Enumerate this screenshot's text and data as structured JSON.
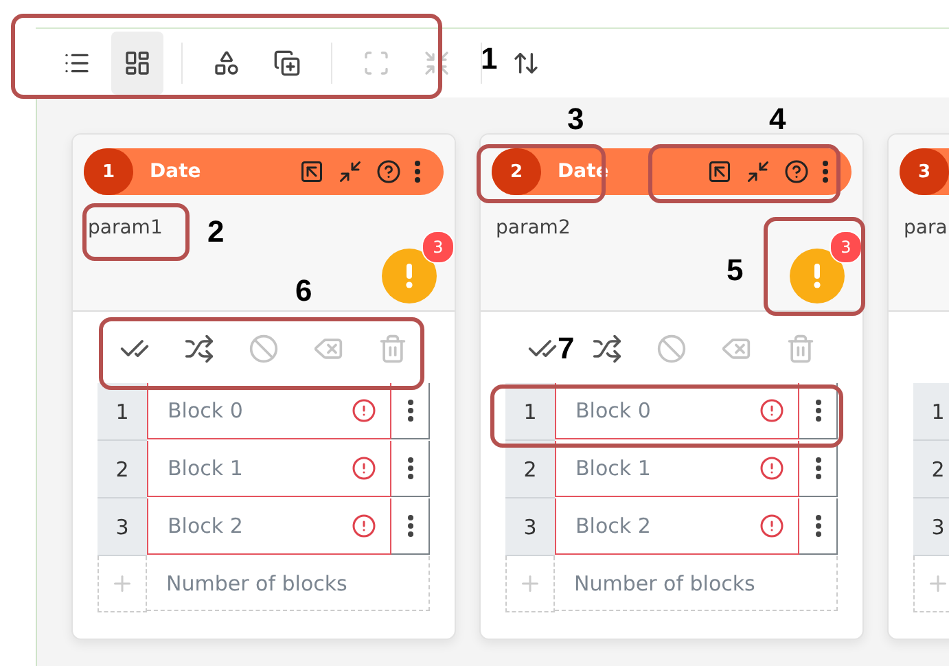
{
  "toolbar": {
    "buttons": [
      {
        "kind": "list",
        "selected": false,
        "disabled": false
      },
      {
        "kind": "dashboard",
        "selected": true,
        "disabled": false
      },
      {
        "kind": "add-shapes",
        "selected": false,
        "disabled": false
      },
      {
        "kind": "copy-plus",
        "selected": false,
        "disabled": false
      },
      {
        "kind": "expand",
        "selected": false,
        "disabled": true
      },
      {
        "kind": "shrink",
        "selected": false,
        "disabled": true
      },
      {
        "kind": "sort",
        "selected": false,
        "disabled": false
      }
    ]
  },
  "cards": [
    {
      "number": "1",
      "label": "Date",
      "title": "param1",
      "alert_count": "3",
      "actions": [
        {
          "kind": "check-all",
          "disabled": false
        },
        {
          "kind": "shuffle",
          "disabled": false
        },
        {
          "kind": "ban",
          "disabled": true
        },
        {
          "kind": "backspace",
          "disabled": true
        },
        {
          "kind": "trash",
          "disabled": true
        }
      ],
      "rows": [
        {
          "index": "1",
          "name": "Block 0",
          "error": true
        },
        {
          "index": "2",
          "name": "Block 1",
          "error": true
        },
        {
          "index": "3",
          "name": "Block 2",
          "error": true
        }
      ],
      "add_placeholder": "Number of blocks"
    },
    {
      "number": "2",
      "label": "Date",
      "title": "param2",
      "alert_count": "3",
      "actions": [
        {
          "kind": "check-all",
          "disabled": false
        },
        {
          "kind": "shuffle",
          "disabled": false
        },
        {
          "kind": "ban",
          "disabled": true
        },
        {
          "kind": "backspace",
          "disabled": true
        },
        {
          "kind": "trash",
          "disabled": true
        }
      ],
      "rows": [
        {
          "index": "1",
          "name": "Block 0",
          "error": true
        },
        {
          "index": "2",
          "name": "Block 1",
          "error": true
        },
        {
          "index": "3",
          "name": "Block 2",
          "error": true
        }
      ],
      "add_placeholder": "Number of blocks"
    },
    {
      "number": "3",
      "title": "para",
      "rows": [
        {
          "index": "1"
        },
        {
          "index": "2"
        },
        {
          "index": "3"
        }
      ]
    }
  ],
  "annotations": [
    {
      "label": "1"
    },
    {
      "label": "2"
    },
    {
      "label": "3"
    },
    {
      "label": "4"
    },
    {
      "label": "5"
    },
    {
      "label": "6"
    },
    {
      "label": "7"
    }
  ]
}
